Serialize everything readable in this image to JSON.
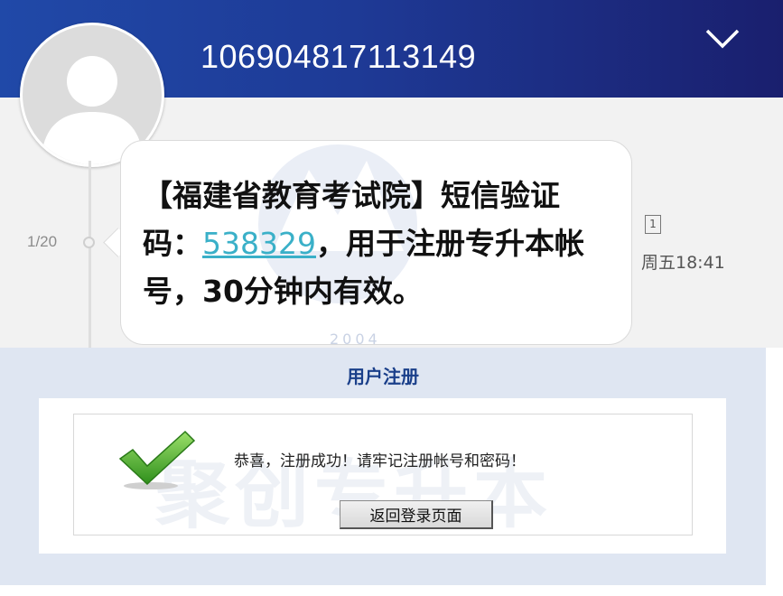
{
  "sms": {
    "sender": "106904817113149",
    "message_counter": "1/20",
    "message": {
      "prefix": "【福建省教育考试院】短信验证码：",
      "code": "538329",
      "suffix": "，用于注册专升本帐号，30分钟内有效。"
    },
    "sim_slot": "1",
    "timestamp": "周五18:41",
    "watermark_year": "2004",
    "icons": {
      "collapse": "chevron-down-icon",
      "avatar": "user-avatar-icon"
    },
    "colors": {
      "header_start": "#2049a8",
      "header_end": "#1a1f6e",
      "code_link": "#3ab0c8"
    }
  },
  "registration": {
    "title": "用户注册",
    "success_message": "恭喜，注册成功！请牢记注册帐号和密码！",
    "back_button_label": "返回登录页面",
    "watermark_text": "聚创专升本",
    "icons": {
      "success": "green-checkmark-icon"
    },
    "colors": {
      "title": "#1a3f8a",
      "background": "#dfe6f2"
    }
  }
}
